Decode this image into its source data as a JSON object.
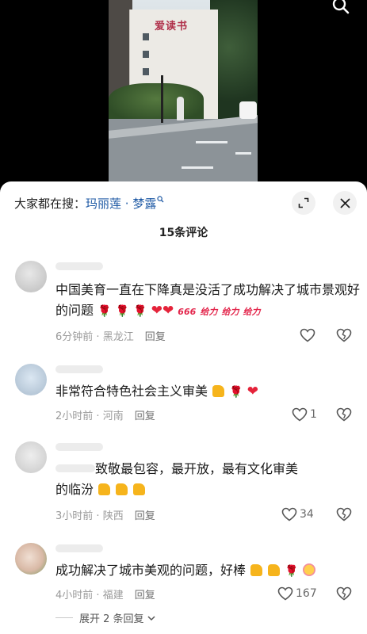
{
  "video": {
    "sign_text": "爱读书"
  },
  "panel": {
    "search_prefix": "大家都在搜：",
    "search_term": "玛丽莲 · 梦露",
    "comment_count_title": "15条评论"
  },
  "comments": [
    {
      "text": "中国美育一直在下降真是没活了成功解决了城市景观好的问题",
      "gift_badges": [
        "666",
        "给力",
        "给力",
        "给力"
      ],
      "time": "6分钟前",
      "location": "黑龙江",
      "reply_label": "回复",
      "likes": ""
    },
    {
      "text": "非常符合特色社会主义审美",
      "time": "2小时前",
      "location": "河南",
      "reply_label": "回复",
      "likes": "1"
    },
    {
      "text_line1": "致敬最包容，最开放，最有文化审美",
      "text_line2": "的临汾",
      "time": "3小时前",
      "location": "陕西",
      "reply_label": "回复",
      "likes": "34"
    },
    {
      "text": "成功解决了城市美观的问题，好棒",
      "time": "4小时前",
      "location": "福建",
      "reply_label": "回复",
      "likes": "167"
    }
  ],
  "expand_replies_label": "展开 2 条回复",
  "meta_separator": " · ",
  "colors": {
    "link": "#1f5aa5",
    "rose": "#d0243c",
    "heart": "#e5233a"
  }
}
